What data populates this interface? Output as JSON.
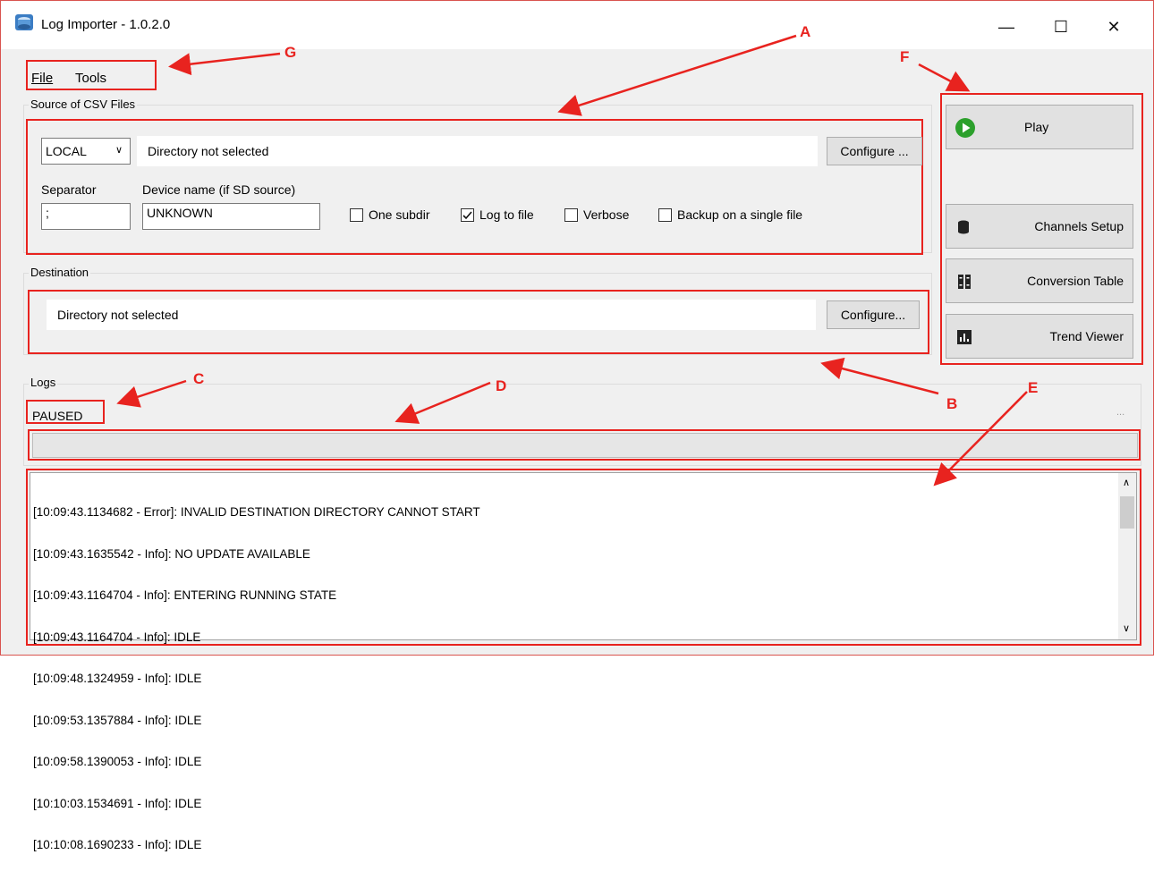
{
  "window": {
    "title": "Log Importer - 1.0.2.0",
    "minimize": "—",
    "maximize": "☐",
    "close": "✕"
  },
  "menu": {
    "file": "File",
    "tools": "Tools"
  },
  "source": {
    "group_label": "Source of CSV Files",
    "mode_value": "LOCAL",
    "directory_text": "Directory not selected",
    "configure_label": "Configure ...",
    "separator_label": "Separator",
    "separator_value": ";",
    "device_label": "Device name (if SD source)",
    "device_value": "UNKNOWN",
    "checkboxes": [
      {
        "label": "One subdir",
        "checked": false
      },
      {
        "label": "Log to file",
        "checked": true
      },
      {
        "label": "Verbose",
        "checked": false
      },
      {
        "label": "Backup on a single file",
        "checked": false
      }
    ]
  },
  "destination": {
    "group_label": "Destination",
    "directory_text": "Directory not selected",
    "configure_label": "Configure..."
  },
  "actions": {
    "play": "Play",
    "channels_setup": "Channels Setup",
    "conversion_table": "Conversion Table",
    "trend_viewer": "Trend Viewer"
  },
  "logs": {
    "group_label": "Logs",
    "status": "PAUSED",
    "ellipsis": "...",
    "lines": [
      "[10:09:43.1134682 - Error]: INVALID DESTINATION DIRECTORY CANNOT START",
      "[10:09:43.1635542 - Info]: NO UPDATE AVAILABLE",
      "[10:09:43.1164704 - Info]: ENTERING RUNNING STATE",
      "[10:09:43.1164704 - Info]: IDLE",
      "[10:09:48.1324959 - Info]: IDLE",
      "[10:09:53.1357884 - Info]: IDLE",
      "[10:09:58.1390053 - Info]: IDLE",
      "[10:10:03.1534691 - Info]: IDLE",
      "[10:10:08.1690233 - Info]: IDLE"
    ]
  },
  "annotations": {
    "a": "A",
    "b": "B",
    "c": "C",
    "d": "D",
    "e": "E",
    "f": "F",
    "g": "G"
  },
  "colors": {
    "annotation": "#e8231f",
    "play_icon": "#2ca02c",
    "window_bg": "#f0f0f0"
  }
}
